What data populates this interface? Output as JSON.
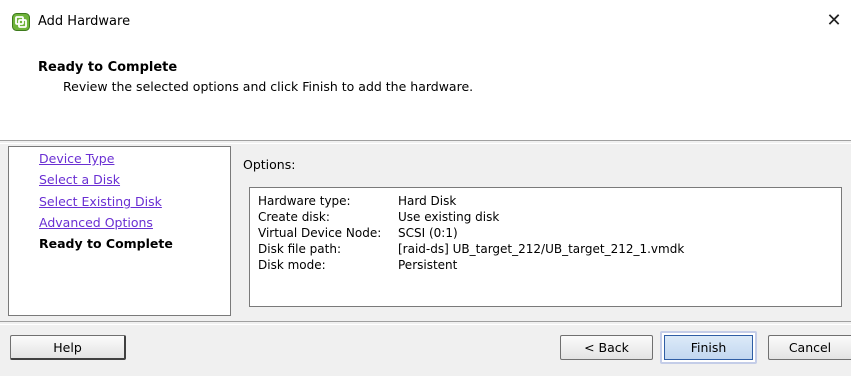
{
  "window": {
    "title": "Add Hardware",
    "icon": "vmware-add-hardware-icon",
    "close_glyph": "✕"
  },
  "header": {
    "title": "Ready to Complete",
    "description": "Review the selected options and click Finish to add the hardware."
  },
  "nav": {
    "items": [
      {
        "label": "Device Type",
        "state": "link"
      },
      {
        "label": "Select a Disk",
        "state": "link"
      },
      {
        "label": "Select Existing Disk",
        "state": "link"
      },
      {
        "label": "Advanced Options",
        "state": "link"
      },
      {
        "label": "Ready to Complete",
        "state": "current"
      }
    ]
  },
  "options": {
    "label": "Options:",
    "rows": [
      {
        "key": "Hardware type:",
        "value": "Hard Disk"
      },
      {
        "key": "Create disk:",
        "value": "Use existing disk"
      },
      {
        "key": "Virtual Device Node:",
        "value": "SCSI (0:1)"
      },
      {
        "key": "Disk file path:",
        "value": "[raid-ds] UB_target_212/UB_target_212_1.vmdk"
      },
      {
        "key": "Disk mode:",
        "value": "Persistent"
      }
    ]
  },
  "buttons": {
    "help": "Help",
    "back": "< Back",
    "finish": "Finish",
    "cancel": "Cancel"
  },
  "colors": {
    "link": "#6a2fd3",
    "band": "#f0f0f0",
    "finish_border": "#2f5ea5"
  }
}
